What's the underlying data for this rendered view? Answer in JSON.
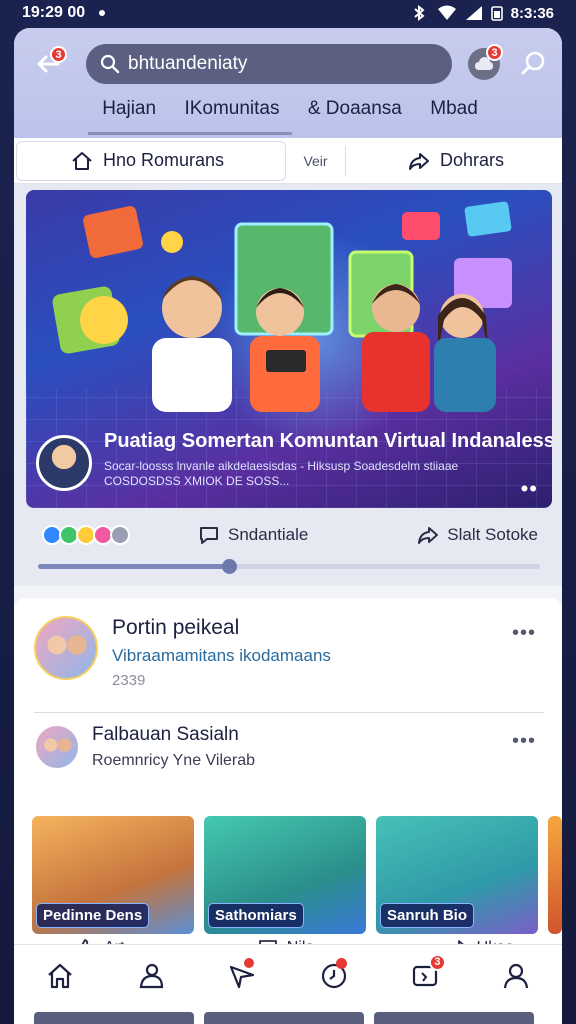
{
  "status_bar": {
    "time": "19:29 00",
    "clock_right": "8:3:36"
  },
  "header": {
    "back_badge": "3",
    "search_value": "bhtuandeniaty",
    "notif_badge": "3",
    "tabs": [
      "Hajian",
      "IKomunitas",
      "& Doaansa",
      "Mbad"
    ]
  },
  "subtabs": {
    "primary": "Hno Romurans",
    "view": "Veir",
    "share": "Dohrars"
  },
  "hero": {
    "title": "Puatiag Somertan Komuntan Virtual Indanalessiall",
    "subtitle": "Socar-loosss lnvanle aikdelaesisdas - Hiksusp Soadesdelm stiiaae COSDOSDSS XMIOK DE SOSS...",
    "progress": 0.38
  },
  "reactions": {
    "comment_label": "Sndantiale",
    "share_label": "Slalt Sotoke"
  },
  "posts": [
    {
      "title": "Portin peikeal",
      "subtitle": "Vibraamamitans ikodamaans",
      "meta": "2339"
    },
    {
      "title": "Falbauan Sasialn",
      "subtitle": "Roemnricy Yne Vilerab"
    }
  ],
  "thumbnails": [
    "Pedinne Dens",
    "Sathomiars",
    "Sanruh Bio"
  ],
  "thumb_actions": {
    "like": "Art",
    "comment": "Nila",
    "share": "Ukao"
  },
  "colors": {
    "accent": "#5b6083",
    "badge": "#e53935",
    "header_bg": "#c8cdee"
  }
}
